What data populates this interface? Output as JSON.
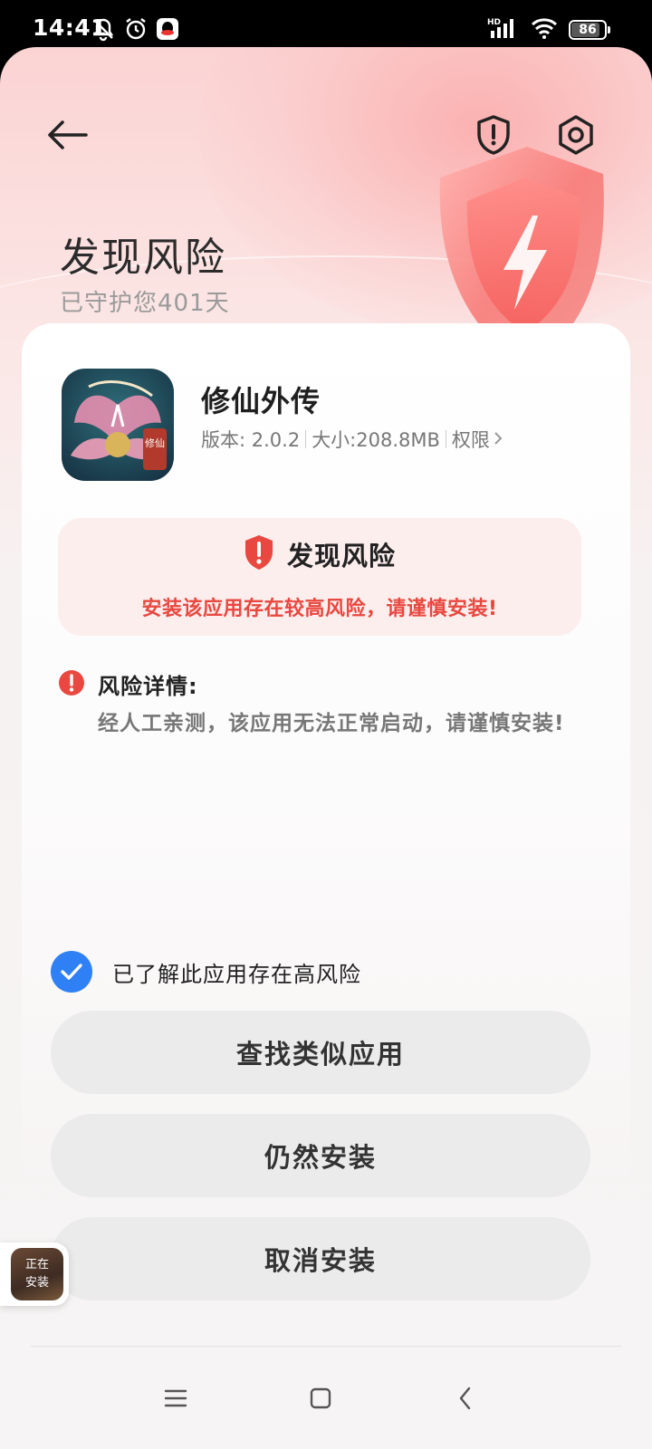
{
  "status_bar": {
    "time": "14:41",
    "network": "HD",
    "battery": "86",
    "battery_level": 0.86
  },
  "header": {
    "title": "发现风险",
    "subtitle": "已守护您401天"
  },
  "app": {
    "name": "修仙外传",
    "icon_text": "修仙",
    "version": "版本: 2.0.2",
    "size": "大小:208.8MB",
    "permissions_link": "权限"
  },
  "risk": {
    "title": "发现风险",
    "warning": "安装该应用存在较高风险，请谨慎安装!"
  },
  "details": {
    "title": "风险详情:",
    "text": "经人工亲测，该应用无法正常启动，请谨慎安装!"
  },
  "agree": {
    "label": "已了解此应用存在高风险",
    "checked": true
  },
  "buttons": {
    "find_similar": "查找类似应用",
    "install_anyway": "仍然安装",
    "cancel_install": "取消安装"
  },
  "floating_status": "正在安装",
  "colors": {
    "accent_red": "#e8483f",
    "check_blue": "#2f80f5",
    "button_gray": "#ebebeb"
  }
}
